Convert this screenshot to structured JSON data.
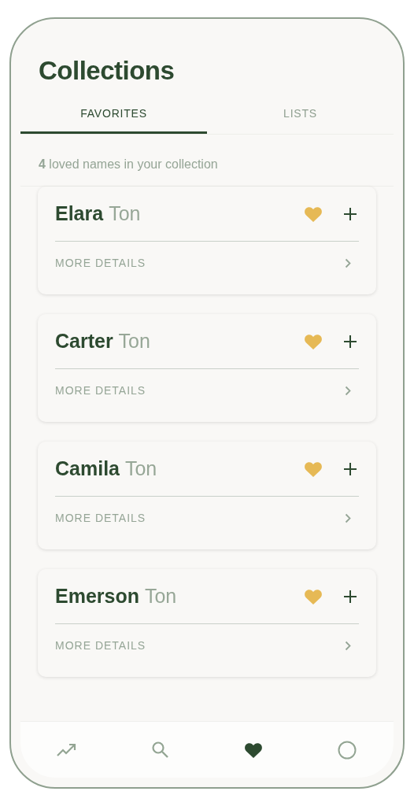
{
  "title": "Collections",
  "tabs": [
    {
      "label": "FAVORITES",
      "selected": true
    },
    {
      "label": "LISTS",
      "selected": false
    }
  ],
  "summary": "**4** loved names in your collection",
  "names": [
    {
      "first": "Elara",
      "last": "Ton",
      "favorited": true,
      "details": "MORE DETAILS"
    },
    {
      "first": "Carter",
      "last": "Ton",
      "favorited": true,
      "details": "MORE DETAILS"
    },
    {
      "first": "Camila",
      "last": "Ton",
      "favorited": true,
      "details": "MORE DETAILS"
    },
    {
      "first": "Emerson",
      "last": "Ton",
      "favorited": true,
      "details": "MORE DETAILS"
    }
  ],
  "nav": [
    {
      "kind": "trending",
      "selected": false
    },
    {
      "kind": "search",
      "selected": false
    },
    {
      "kind": "favorites",
      "selected": true
    },
    {
      "kind": "profile",
      "selected": false
    }
  ]
}
